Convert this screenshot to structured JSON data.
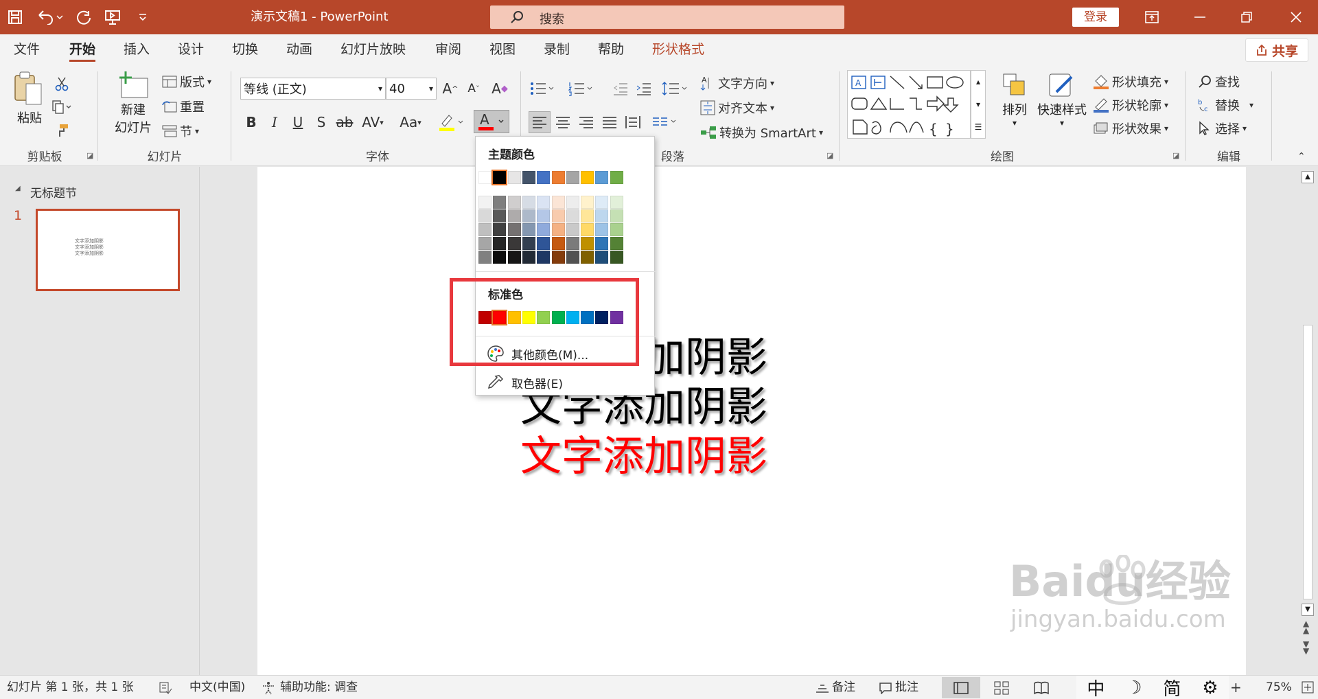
{
  "titlebar": {
    "doc_title": "演示文稿1  -  PowerPoint",
    "search_label": "搜索",
    "login_label": "登录"
  },
  "menu": {
    "tabs": [
      "文件",
      "开始",
      "插入",
      "设计",
      "切换",
      "动画",
      "幻灯片放映",
      "审阅",
      "视图",
      "录制",
      "帮助",
      "形状格式"
    ],
    "active_tab": "开始",
    "share_label": "共享"
  },
  "ribbon": {
    "clipboard": {
      "paste": "粘贴",
      "group": "剪贴板"
    },
    "slides": {
      "new_slide_1": "新建",
      "new_slide_2": "幻灯片",
      "layout": "版式",
      "reset": "重置",
      "section": "节",
      "group": "幻灯片"
    },
    "font": {
      "font_name": "等线 (正文)",
      "font_size": "40",
      "group": "字体"
    },
    "paragraph": {
      "text_direction": "文字方向",
      "align_text": "对齐文本",
      "smartart": "转换为 SmartArt",
      "group": "段落"
    },
    "drawing": {
      "arrange": "排列",
      "quick_styles": "快速样式",
      "shape_fill": "形状填充",
      "shape_outline": "形状轮廓",
      "shape_effects": "形状效果",
      "group": "绘图"
    },
    "editing": {
      "find": "查找",
      "replace": "替换",
      "select": "选择",
      "group": "编辑"
    }
  },
  "left_panel": {
    "section": "无标题节",
    "slide_number": "1",
    "thumb_lines": [
      "文字添加阴影",
      "文字添加阴影",
      "文字添加阴影"
    ]
  },
  "slide": {
    "lines": [
      "文字添加阴影",
      "文字添加阴影",
      "文字添加阴影"
    ],
    "line_colors": [
      "#000000",
      "#000000",
      "#ff0000"
    ]
  },
  "font_color_menu": {
    "theme_title": "主题颜色",
    "standard_title": "标准色",
    "theme_colors": [
      "#ffffff",
      "#000000",
      "#e7e6e6",
      "#44546a",
      "#4472c4",
      "#ed7d31",
      "#a5a5a5",
      "#ffc000",
      "#5b9bd5",
      "#70ad47"
    ],
    "theme_shades": [
      [
        "#f2f2f2",
        "#d9d9d9",
        "#bfbfbf",
        "#a6a6a6",
        "#808080"
      ],
      [
        "#7f7f7f",
        "#595959",
        "#404040",
        "#262626",
        "#0d0d0d"
      ],
      [
        "#d0cece",
        "#aeabab",
        "#757171",
        "#3a3838",
        "#171616"
      ],
      [
        "#d6dce5",
        "#adb9ca",
        "#8497b0",
        "#333f50",
        "#222a35"
      ],
      [
        "#dae3f3",
        "#b4c7e7",
        "#8faadc",
        "#2f5597",
        "#1f3864"
      ],
      [
        "#fbe5d6",
        "#f8cbad",
        "#f4b183",
        "#c55a11",
        "#843c0c"
      ],
      [
        "#ededed",
        "#dbdbdb",
        "#c9c9c9",
        "#7b7b7b",
        "#525252"
      ],
      [
        "#fff2cc",
        "#ffe699",
        "#ffd966",
        "#bf9000",
        "#7f6000"
      ],
      [
        "#deebf7",
        "#bdd7ee",
        "#9dc3e6",
        "#2e75b6",
        "#1f4e79"
      ],
      [
        "#e2f0d9",
        "#c5e0b4",
        "#a9d18e",
        "#548235",
        "#385723"
      ]
    ],
    "standard_colors": [
      "#c00000",
      "#ff0000",
      "#ffc000",
      "#ffff00",
      "#92d050",
      "#00b050",
      "#00b0f0",
      "#0070c0",
      "#002060",
      "#7030a0"
    ],
    "more_colors": "其他颜色(M)...",
    "eyedropper": "取色器(E)"
  },
  "status": {
    "slide_info": "幻灯片 第 1 张，共 1 张",
    "language": "中文(中国)",
    "accessibility": "辅助功能: 调查",
    "notes": "备注",
    "comments": "批注",
    "ime_chars": [
      "中",
      "简"
    ],
    "zoom": "75%"
  },
  "watermark": {
    "main": "Baidu经验",
    "sub": "jingyan.baidu.com"
  },
  "colors": {
    "brand": "#b7472a",
    "highlight_box": "#e8383d"
  }
}
